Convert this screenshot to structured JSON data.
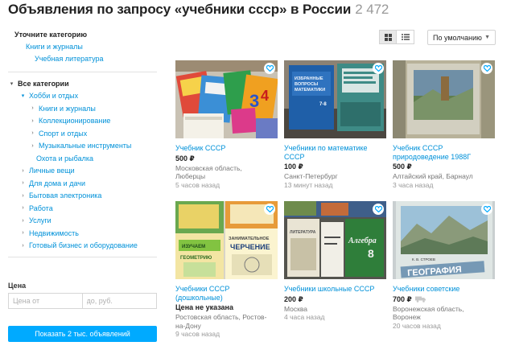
{
  "header": {
    "title": "Объявления по запросу «учебники ссср» в России",
    "count": "2 472"
  },
  "sidebar": {
    "refine": {
      "heading": "Уточните категорию",
      "items": [
        {
          "label": "Книги и журналы"
        },
        {
          "label": "Учебная литература"
        }
      ]
    },
    "categories": {
      "heading": "Все категории",
      "hobby": "Хобби и отдых",
      "hobby_sub": [
        {
          "label": "Книги и журналы"
        },
        {
          "label": "Коллекционирование"
        },
        {
          "label": "Спорт и отдых"
        },
        {
          "label": "Музыкальные инструменты"
        },
        {
          "label": "Охота и рыбалка"
        }
      ],
      "other": [
        {
          "label": "Личные вещи"
        },
        {
          "label": "Для дома и дачи"
        },
        {
          "label": "Бытовая электроника"
        },
        {
          "label": "Работа"
        },
        {
          "label": "Услуги"
        },
        {
          "label": "Недвижимость"
        },
        {
          "label": "Готовый бизнес и оборудование"
        }
      ]
    },
    "price": {
      "label": "Цена",
      "from_placeholder": "Цена от",
      "to_placeholder": "до, руб."
    },
    "show_button": "Показать 2 тыс. объявлений"
  },
  "toolbar": {
    "sort_value": "По умолчанию"
  },
  "listings": [
    {
      "title_lines": [
        "Учебник СССР",
        ""
      ],
      "price": "500 ₽",
      "loc_lines": [
        "Московская область,",
        "Люберцы"
      ],
      "time": "5 часов назад"
    },
    {
      "title_lines": [
        "Учебники по математике",
        "СССР"
      ],
      "price": "100 ₽",
      "loc_lines": [
        "Санкт-Петербург",
        ""
      ],
      "time": "13 минут назад"
    },
    {
      "title_lines": [
        "Учебник СССР",
        "природоведение 1988Г"
      ],
      "price": "500 ₽",
      "loc_lines": [
        "Алтайский край, Барнаул",
        ""
      ],
      "time": "3 часа назад"
    },
    {
      "title_lines": [
        "Учебники СССР",
        "(дошкольные)"
      ],
      "price": "Цена не указана",
      "loc_lines": [
        "Ростовская область, Ростов-",
        "на-Дону"
      ],
      "time": "9 часов назад"
    },
    {
      "title_lines": [
        "Учебники школьные СССР",
        ""
      ],
      "price": "200 ₽",
      "loc_lines": [
        "Москва",
        ""
      ],
      "time": "4 часа назад"
    },
    {
      "title_lines": [
        "Учебники советские",
        ""
      ],
      "price": "700 ₽",
      "loc_lines": [
        "Воронежская область,",
        "Воронеж"
      ],
      "time": "20 часов назад"
    }
  ],
  "photo_text": {
    "p2_line1": "ИЗБРАННЫЕ",
    "p2_line2": "ВОПРОСЫ",
    "p2_line3": "МАТЕМАТИКИ",
    "p2_grade": "7-8",
    "p4_left": "ИЗУЧАЕМ",
    "p4_left2": "ГЕОМЕТРИЮ",
    "p4_right": "ЗАНИМАТЕЛЬНОЕ",
    "p4_right2": "ЧЕРЧЕНИЕ",
    "p5_lit": "ЛИТЕРАТУРА",
    "p5_alg": "Алгебра",
    "p5_num": "8",
    "p6_author": "К. В. СТРОЕВ",
    "p6_title": "ГЕОГРАФИЯ"
  },
  "colors": {
    "link": "#0091d9",
    "button": "#00aaff"
  }
}
